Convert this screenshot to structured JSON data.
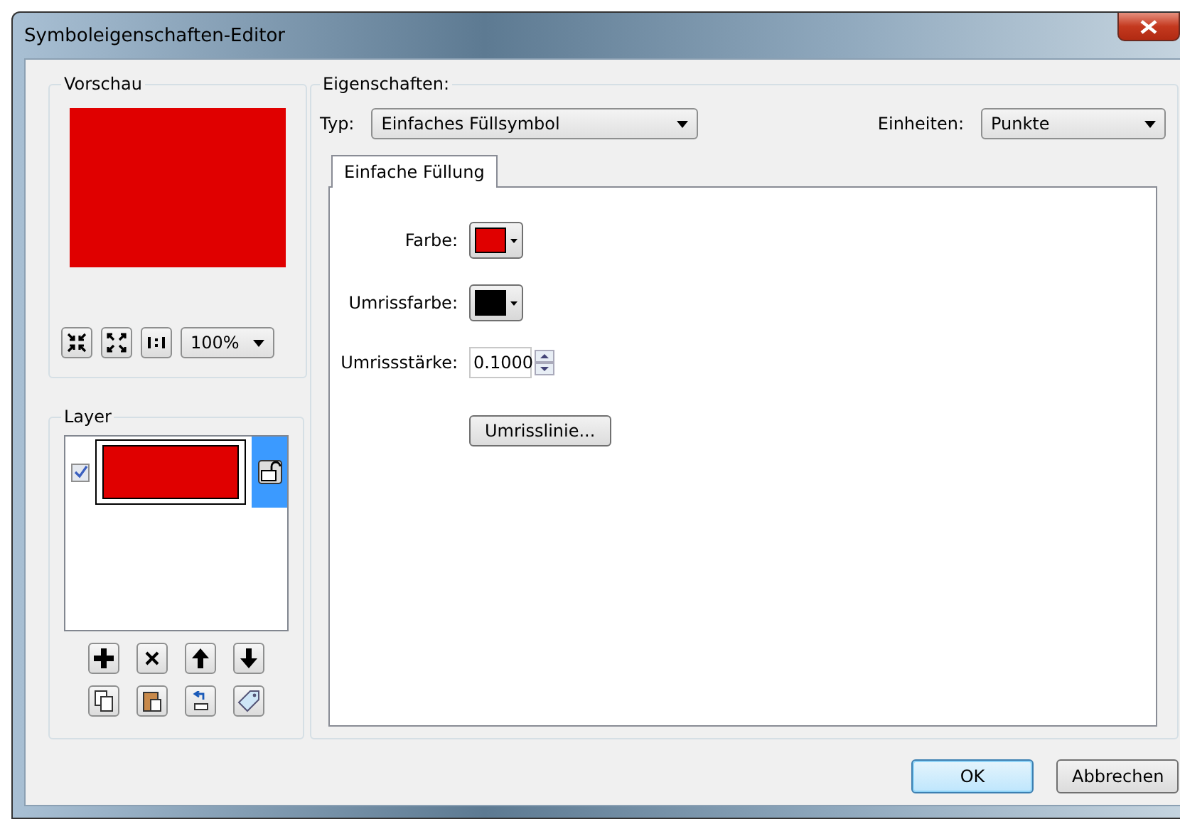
{
  "window": {
    "title": "Symboleigenschaften-Editor"
  },
  "preview": {
    "label": "Vorschau",
    "color": "#e00000",
    "zoom": "100%"
  },
  "layer": {
    "label": "Layer",
    "items": [
      {
        "checked": true,
        "selected": true,
        "color": "#e00000"
      }
    ]
  },
  "properties": {
    "label": "Eigenschaften:",
    "type_label": "Typ:",
    "type": "Einfaches Füllsymbol",
    "units_label": "Einheiten:",
    "units": "Punkte",
    "tabs": [
      {
        "label": "Einfache Füllung",
        "selected": true
      }
    ],
    "fields": [
      {
        "kind": "color",
        "label": "Farbe:",
        "color": "#e00000"
      },
      {
        "kind": "color",
        "label": "Umrissfarbe:",
        "color": "#000000"
      },
      {
        "kind": "spin",
        "label": "Umrissstärke:",
        "value": "0.1000"
      }
    ],
    "outline_button": "Umrisslinie..."
  },
  "buttons": [
    {
      "label": "OK",
      "default": true
    },
    {
      "label": "Abbrechen",
      "default": false
    }
  ]
}
